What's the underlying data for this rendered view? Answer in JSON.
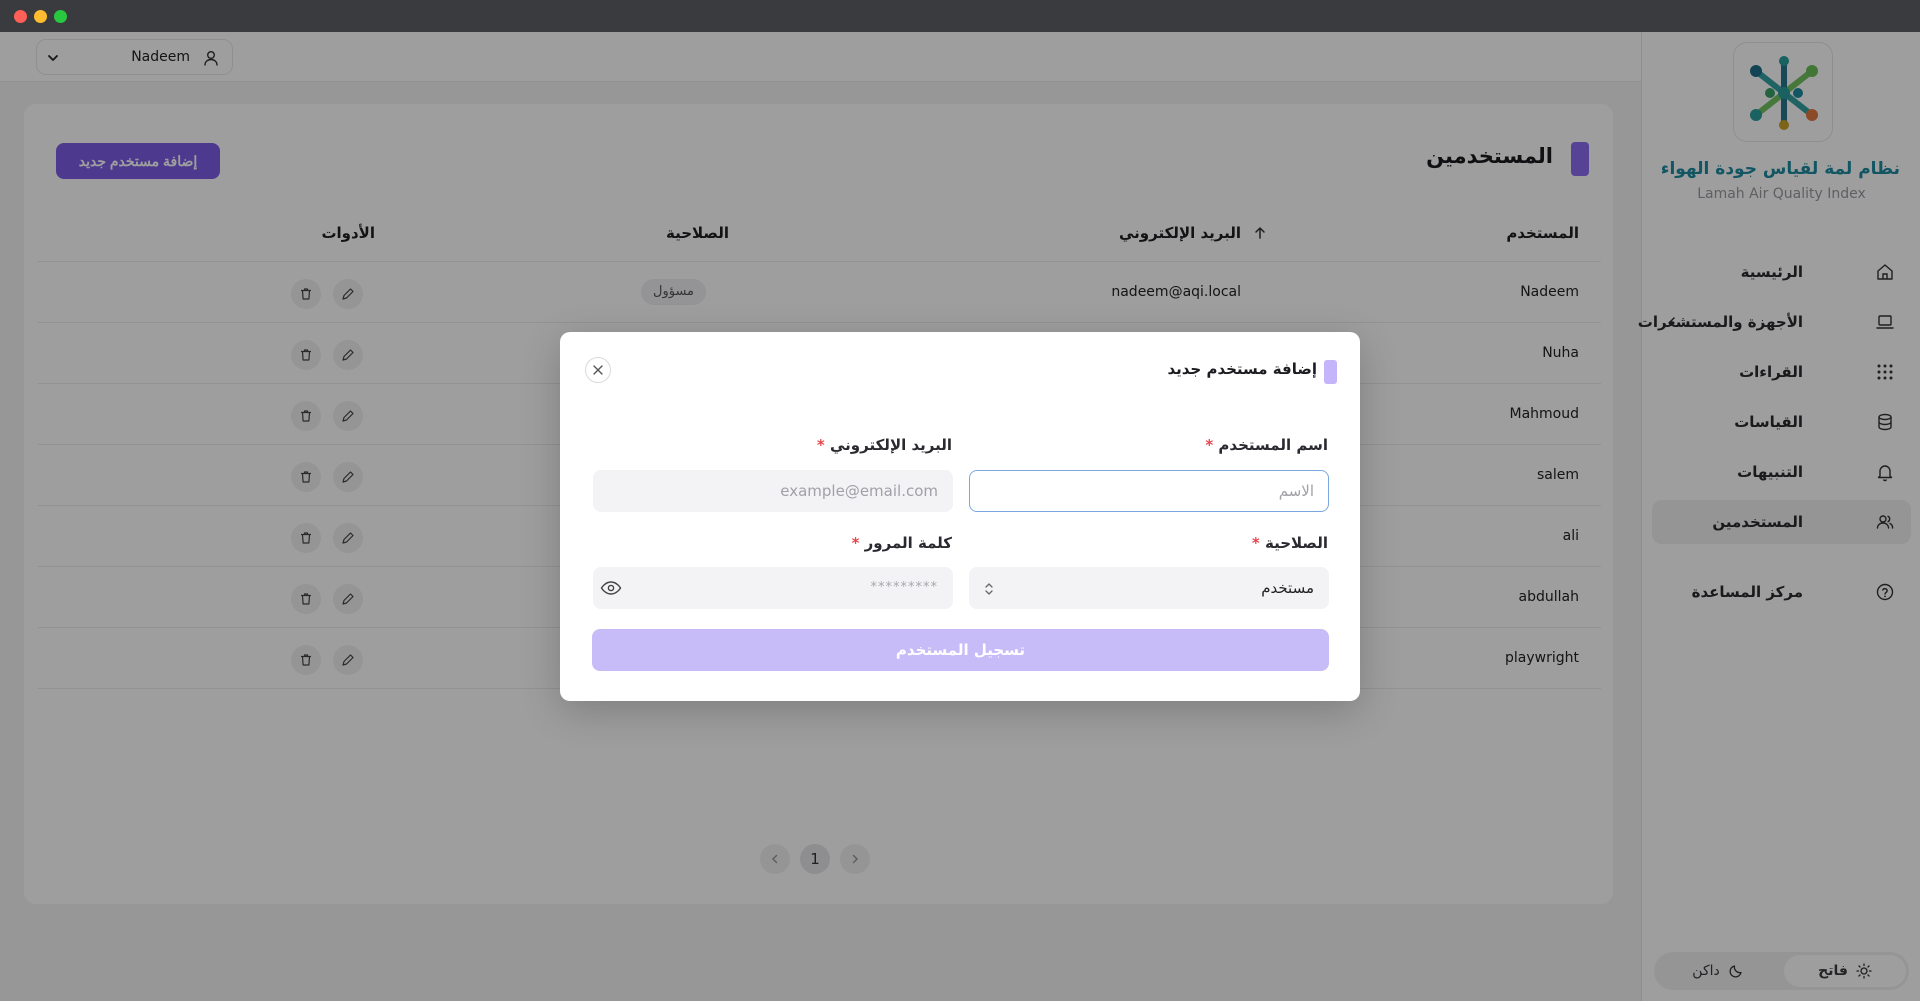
{
  "sidebar": {
    "brand_title": "نظام لمة لقياس جودة الهواء",
    "brand_subtitle": "Lamah Air Quality Index",
    "items": [
      {
        "label": "الرئيسية",
        "icon": "home-icon"
      },
      {
        "label": "الأجهزة والمستشعرات",
        "icon": "laptop-icon",
        "has_chevron": true
      },
      {
        "label": "القراءات",
        "icon": "grid-icon"
      },
      {
        "label": "القياسات",
        "icon": "database-icon"
      },
      {
        "label": "التنبيهات",
        "icon": "bell-icon"
      },
      {
        "label": "المستخدمين",
        "icon": "users-icon",
        "active": true
      }
    ],
    "help_label": "مركز المساعدة",
    "theme": {
      "light_label": "فاتح",
      "dark_label": "داكن",
      "selected": "light"
    }
  },
  "topbar": {
    "username": "Nadeem"
  },
  "page": {
    "title": "المستخدمين",
    "add_button_label": "إضافة مستخدم جديد"
  },
  "table": {
    "headers": {
      "user": "المستخدم",
      "email": "البريد الإلكتروني",
      "role": "الصلاحية",
      "tools": "الأدوات"
    },
    "rows": [
      {
        "user": "Nadeem",
        "email": "nadeem@aqi.local",
        "role": "مسؤول"
      },
      {
        "user": "Nuha",
        "email": "",
        "role": ""
      },
      {
        "user": "Mahmoud",
        "email": "",
        "role": ""
      },
      {
        "user": "salem",
        "email": "",
        "role": ""
      },
      {
        "user": "ali",
        "email": "",
        "role": ""
      },
      {
        "user": "abdullah",
        "email": "",
        "role": ""
      },
      {
        "user": "playwright",
        "email": "",
        "role": ""
      }
    ]
  },
  "pagination": {
    "current_page": "1"
  },
  "modal": {
    "title": "إضافة مستخدم جديد",
    "name_label": "اسم المستخدم",
    "name_placeholder": "الاسم",
    "email_label": "البريد الإلكتروني",
    "email_placeholder": "example@email.com",
    "role_label": "الصلاحية",
    "role_value": "مستخدم",
    "password_label": "كلمة المرور",
    "password_mask": "*********",
    "required_mark": "*",
    "submit_label": "تسجيل المستخدم"
  },
  "colors": {
    "accent": "#7c5ce6",
    "accent_light": "#c4b5fb",
    "brand_teal": "#1d8aa0",
    "required": "#e5484d"
  }
}
